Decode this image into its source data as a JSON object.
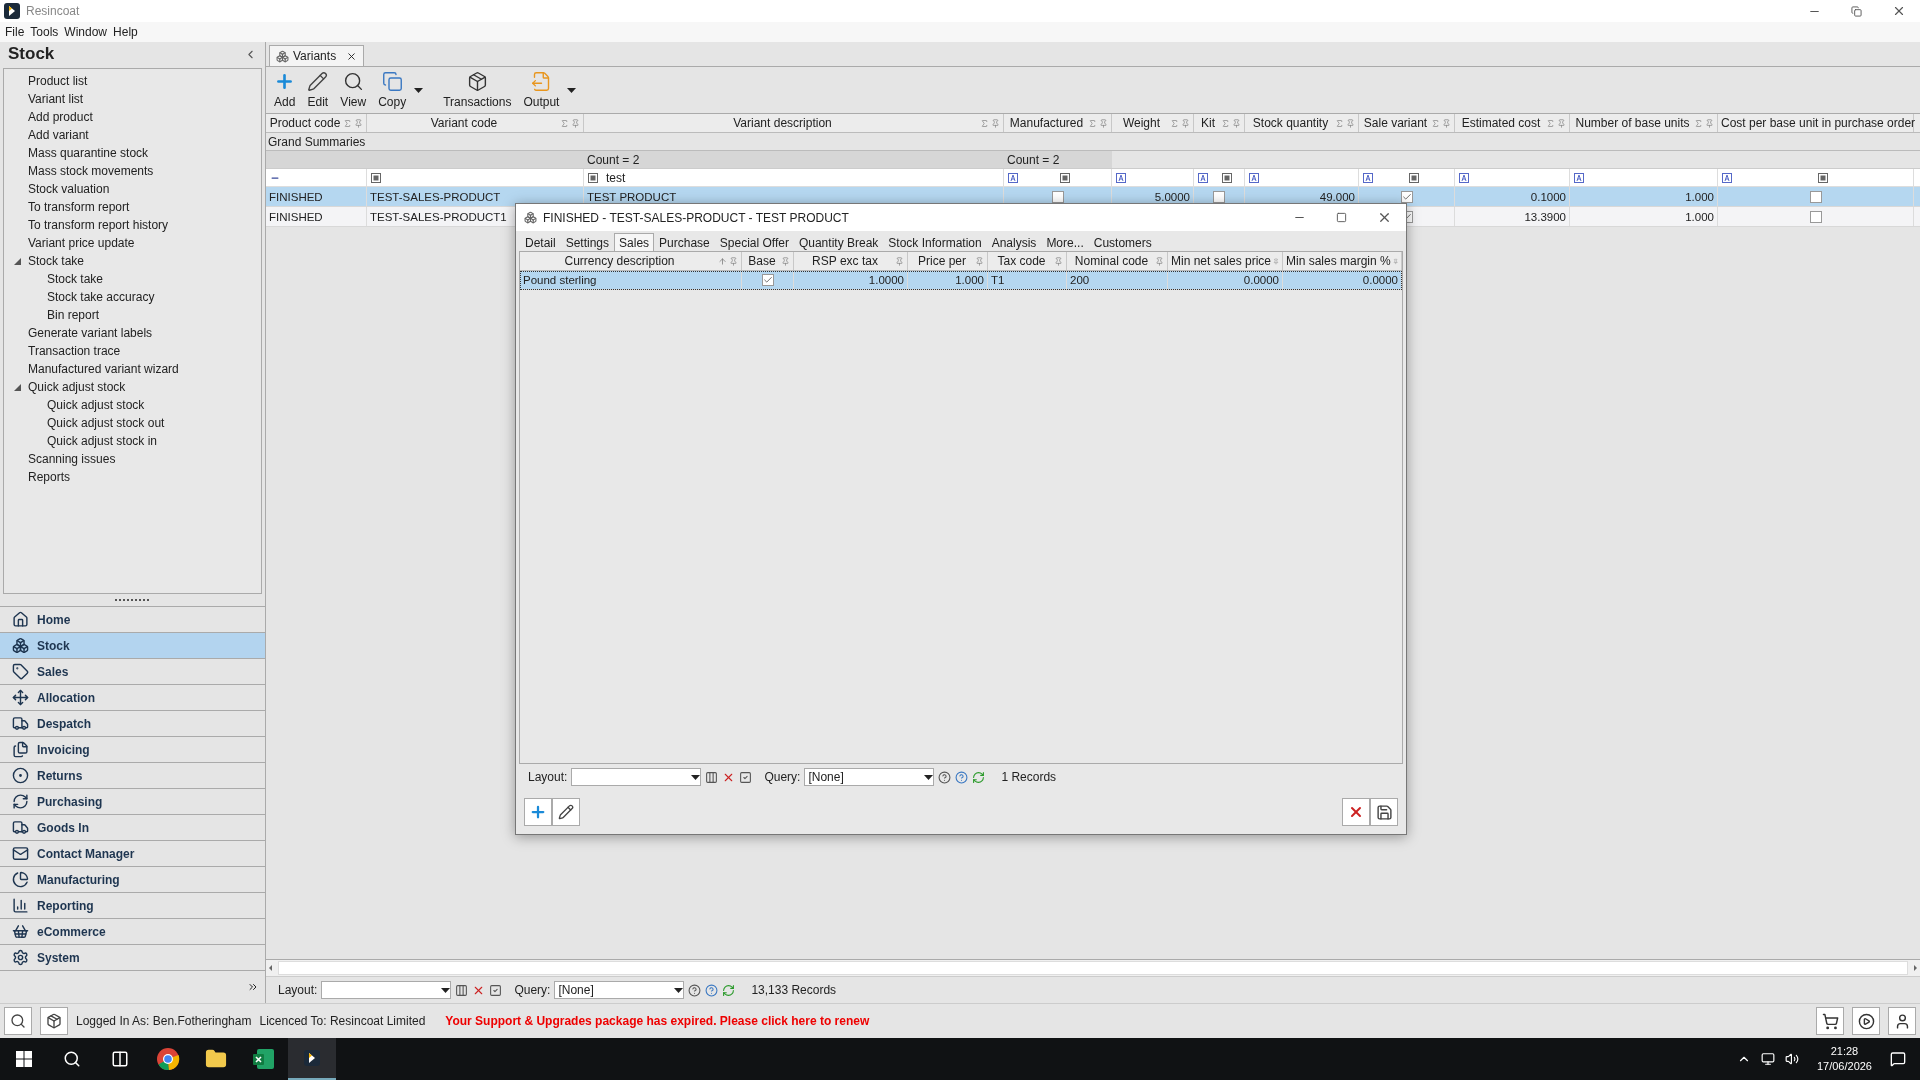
{
  "window": {
    "title": "Resincoat"
  },
  "menu": [
    "File",
    "Tools",
    "Window",
    "Help"
  ],
  "sidebar": {
    "title": "Stock",
    "tree": [
      {
        "label": "Product list"
      },
      {
        "label": "Variant list"
      },
      {
        "label": "Add product"
      },
      {
        "label": "Add variant"
      },
      {
        "label": "Mass quarantine stock"
      },
      {
        "label": "Mass stock movements"
      },
      {
        "label": "Stock valuation"
      },
      {
        "label": "To transform report"
      },
      {
        "label": "To transform report history"
      },
      {
        "label": "Variant price update"
      },
      {
        "label": "Stock take",
        "expanded": true,
        "children": [
          {
            "label": "Stock take"
          },
          {
            "label": "Stock take accuracy"
          },
          {
            "label": "Bin report"
          }
        ]
      },
      {
        "label": "Generate variant labels"
      },
      {
        "label": "Transaction trace"
      },
      {
        "label": "Manufactured variant wizard"
      },
      {
        "label": "Quick adjust stock",
        "expanded": true,
        "children": [
          {
            "label": "Quick adjust stock"
          },
          {
            "label": "Quick adjust stock out"
          },
          {
            "label": "Quick adjust stock in"
          }
        ]
      },
      {
        "label": "Scanning issues"
      },
      {
        "label": "Reports"
      }
    ]
  },
  "nav": [
    {
      "label": "Home",
      "selected": false
    },
    {
      "label": "Stock",
      "selected": true
    },
    {
      "label": "Sales",
      "selected": false
    },
    {
      "label": "Allocation",
      "selected": false
    },
    {
      "label": "Despatch",
      "selected": false
    },
    {
      "label": "Invoicing",
      "selected": false
    },
    {
      "label": "Returns",
      "selected": false
    },
    {
      "label": "Purchasing",
      "selected": false
    },
    {
      "label": "Goods In",
      "selected": false
    },
    {
      "label": "Contact Manager",
      "selected": false
    },
    {
      "label": "Manufacturing",
      "selected": false
    },
    {
      "label": "Reporting",
      "selected": false
    },
    {
      "label": "eCommerce",
      "selected": false
    },
    {
      "label": "System",
      "selected": false
    }
  ],
  "document_tab": {
    "label": "Variants"
  },
  "toolbar": [
    {
      "label": "Add",
      "dropdown": false
    },
    {
      "label": "Edit",
      "dropdown": false
    },
    {
      "label": "View",
      "dropdown": false
    },
    {
      "label": "Copy",
      "dropdown": true
    },
    {
      "label": "Transactions",
      "dropdown": false
    },
    {
      "label": "Output",
      "dropdown": true
    }
  ],
  "grid": {
    "group_label": "Grand Summaries",
    "columns": [
      {
        "label": "Product code",
        "kind": "text"
      },
      {
        "label": "Variant code",
        "kind": "text"
      },
      {
        "label": "Variant description",
        "kind": "text",
        "summary": "Count = 2",
        "filter": "test"
      },
      {
        "label": "Manufactured",
        "kind": "check",
        "summary": "Count = 2"
      },
      {
        "label": "Weight",
        "kind": "number"
      },
      {
        "label": "Kit",
        "kind": "check"
      },
      {
        "label": "Stock quantity",
        "kind": "number"
      },
      {
        "label": "Sale variant",
        "kind": "check"
      },
      {
        "label": "Estimated cost",
        "kind": "number"
      },
      {
        "label": "Number of base units",
        "kind": "number"
      },
      {
        "label": "Cost per base unit in purchase order",
        "kind": "check"
      }
    ],
    "rows": [
      {
        "selected": true,
        "cells": [
          "FINISHED",
          "TEST-SALES-PRODUCT",
          "TEST PRODUCT",
          false,
          "5.0000",
          false,
          "49.000",
          true,
          "0.1000",
          "1.000",
          false
        ]
      },
      {
        "selected": false,
        "cells": [
          "FINISHED",
          "TEST-SALES-PRODUCT1",
          null,
          null,
          null,
          null,
          null,
          true,
          "13.3900",
          "1.000",
          false
        ]
      }
    ]
  },
  "layout_bar": {
    "layout_label": "Layout:",
    "query_label": "Query:",
    "query_value": "[None]",
    "records": "13,133 Records"
  },
  "dialog": {
    "title": "FINISHED - TEST-SALES-PRODUCT - TEST PRODUCT",
    "tabs": [
      {
        "label": "Detail",
        "selected": false
      },
      {
        "label": "Settings",
        "selected": false
      },
      {
        "label": "Sales",
        "selected": true
      },
      {
        "label": "Purchase",
        "selected": false
      },
      {
        "label": "Special Offer",
        "selected": false
      },
      {
        "label": "Quantity Break",
        "selected": false
      },
      {
        "label": "Stock Information",
        "selected": false
      },
      {
        "label": "Analysis",
        "selected": false
      },
      {
        "label": "More...",
        "selected": false
      },
      {
        "label": "Customers",
        "selected": false
      }
    ],
    "columns": [
      {
        "label": "Currency description",
        "kind": "text"
      },
      {
        "label": "Base",
        "kind": "check"
      },
      {
        "label": "RSP exc tax",
        "kind": "number"
      },
      {
        "label": "Price per",
        "kind": "number"
      },
      {
        "label": "Tax code",
        "kind": "text"
      },
      {
        "label": "Nominal code",
        "kind": "text"
      },
      {
        "label": "Min net sales price",
        "kind": "number"
      },
      {
        "label": "Min sales margin %",
        "kind": "number"
      }
    ],
    "rows": [
      {
        "selected": true,
        "cells": [
          "Pound sterling",
          true,
          "1.0000",
          "1.000",
          "T1",
          "200",
          "0.0000",
          "0.0000"
        ]
      }
    ],
    "layout_bar": {
      "layout_label": "Layout:",
      "query_label": "Query:",
      "query_value": "[None]",
      "records": "1 Records"
    }
  },
  "status": {
    "logged_in": "Logged In As: Ben.Fotheringham",
    "licence": "Licenced To: Resincoat Limited",
    "warning": "Your Support & Upgrades package has expired. Please click here to renew"
  },
  "taskbar": {
    "time": "21:28",
    "date": "17/06/2026"
  }
}
